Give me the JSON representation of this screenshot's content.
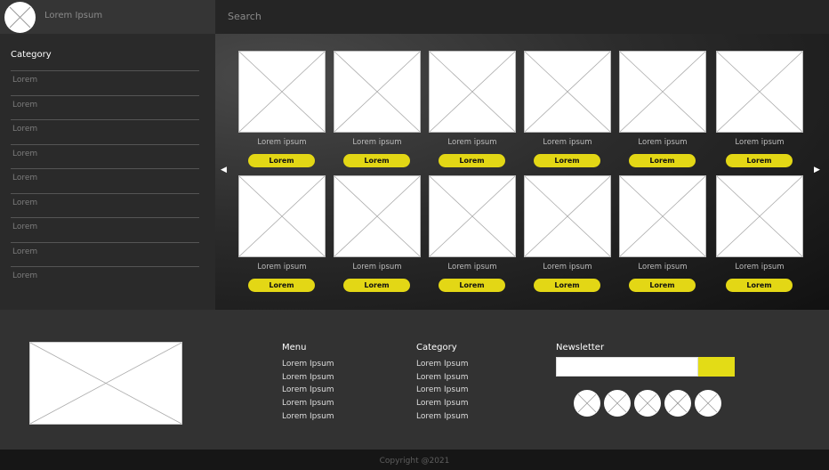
{
  "header": {
    "brand": "Lorem Ipsum",
    "search_placeholder": "Search"
  },
  "sidebar": {
    "title": "Category",
    "items": [
      "Lorem",
      "Lorem",
      "Lorem",
      "Lorem",
      "Lorem",
      "Lorem",
      "Lorem",
      "Lorem",
      "Lorem"
    ]
  },
  "products": {
    "row1": [
      {
        "label": "Lorem ipsum",
        "button": "Lorem"
      },
      {
        "label": "Lorem ipsum",
        "button": "Lorem"
      },
      {
        "label": "Lorem ipsum",
        "button": "Lorem"
      },
      {
        "label": "Lorem ipsum",
        "button": "Lorem"
      },
      {
        "label": "Lorem ipsum",
        "button": "Lorem"
      },
      {
        "label": "Lorem ipsum",
        "button": "Lorem"
      }
    ],
    "row2": [
      {
        "label": "Lorem ipsum",
        "button": "Lorem"
      },
      {
        "label": "Lorem ipsum",
        "button": "Lorem"
      },
      {
        "label": "Lorem ipsum",
        "button": "Lorem"
      },
      {
        "label": "Lorem ipsum",
        "button": "Lorem"
      },
      {
        "label": "Lorem ipsum",
        "button": "Lorem"
      },
      {
        "label": "Lorem ipsum",
        "button": "Lorem"
      }
    ],
    "prev_arrow": "◀",
    "next_arrow": "▶"
  },
  "footer": {
    "menu": {
      "title": "Menu",
      "links": [
        "Lorem Ipsum",
        "Lorem Ipsum",
        "Lorem Ipsum",
        "Lorem Ipsum",
        "Lorem Ipsum"
      ]
    },
    "category": {
      "title": "Category",
      "links": [
        "Lorem Ipsum",
        "Lorem Ipsum",
        "Lorem Ipsum",
        "Lorem Ipsum",
        "Lorem Ipsum"
      ]
    },
    "newsletter": {
      "title": "Newsletter",
      "input_value": ""
    },
    "social_count_label": "5",
    "copyright": "Copyright @2021"
  },
  "colors": {
    "accent": "#e3d715",
    "header_dark": "#353535",
    "footer": "#323232"
  },
  "icons": {
    "logo": "placeholder-image-icon",
    "social": "placeholder-circle-icon",
    "prev": "chevron-left-icon",
    "next": "chevron-right-icon"
  }
}
